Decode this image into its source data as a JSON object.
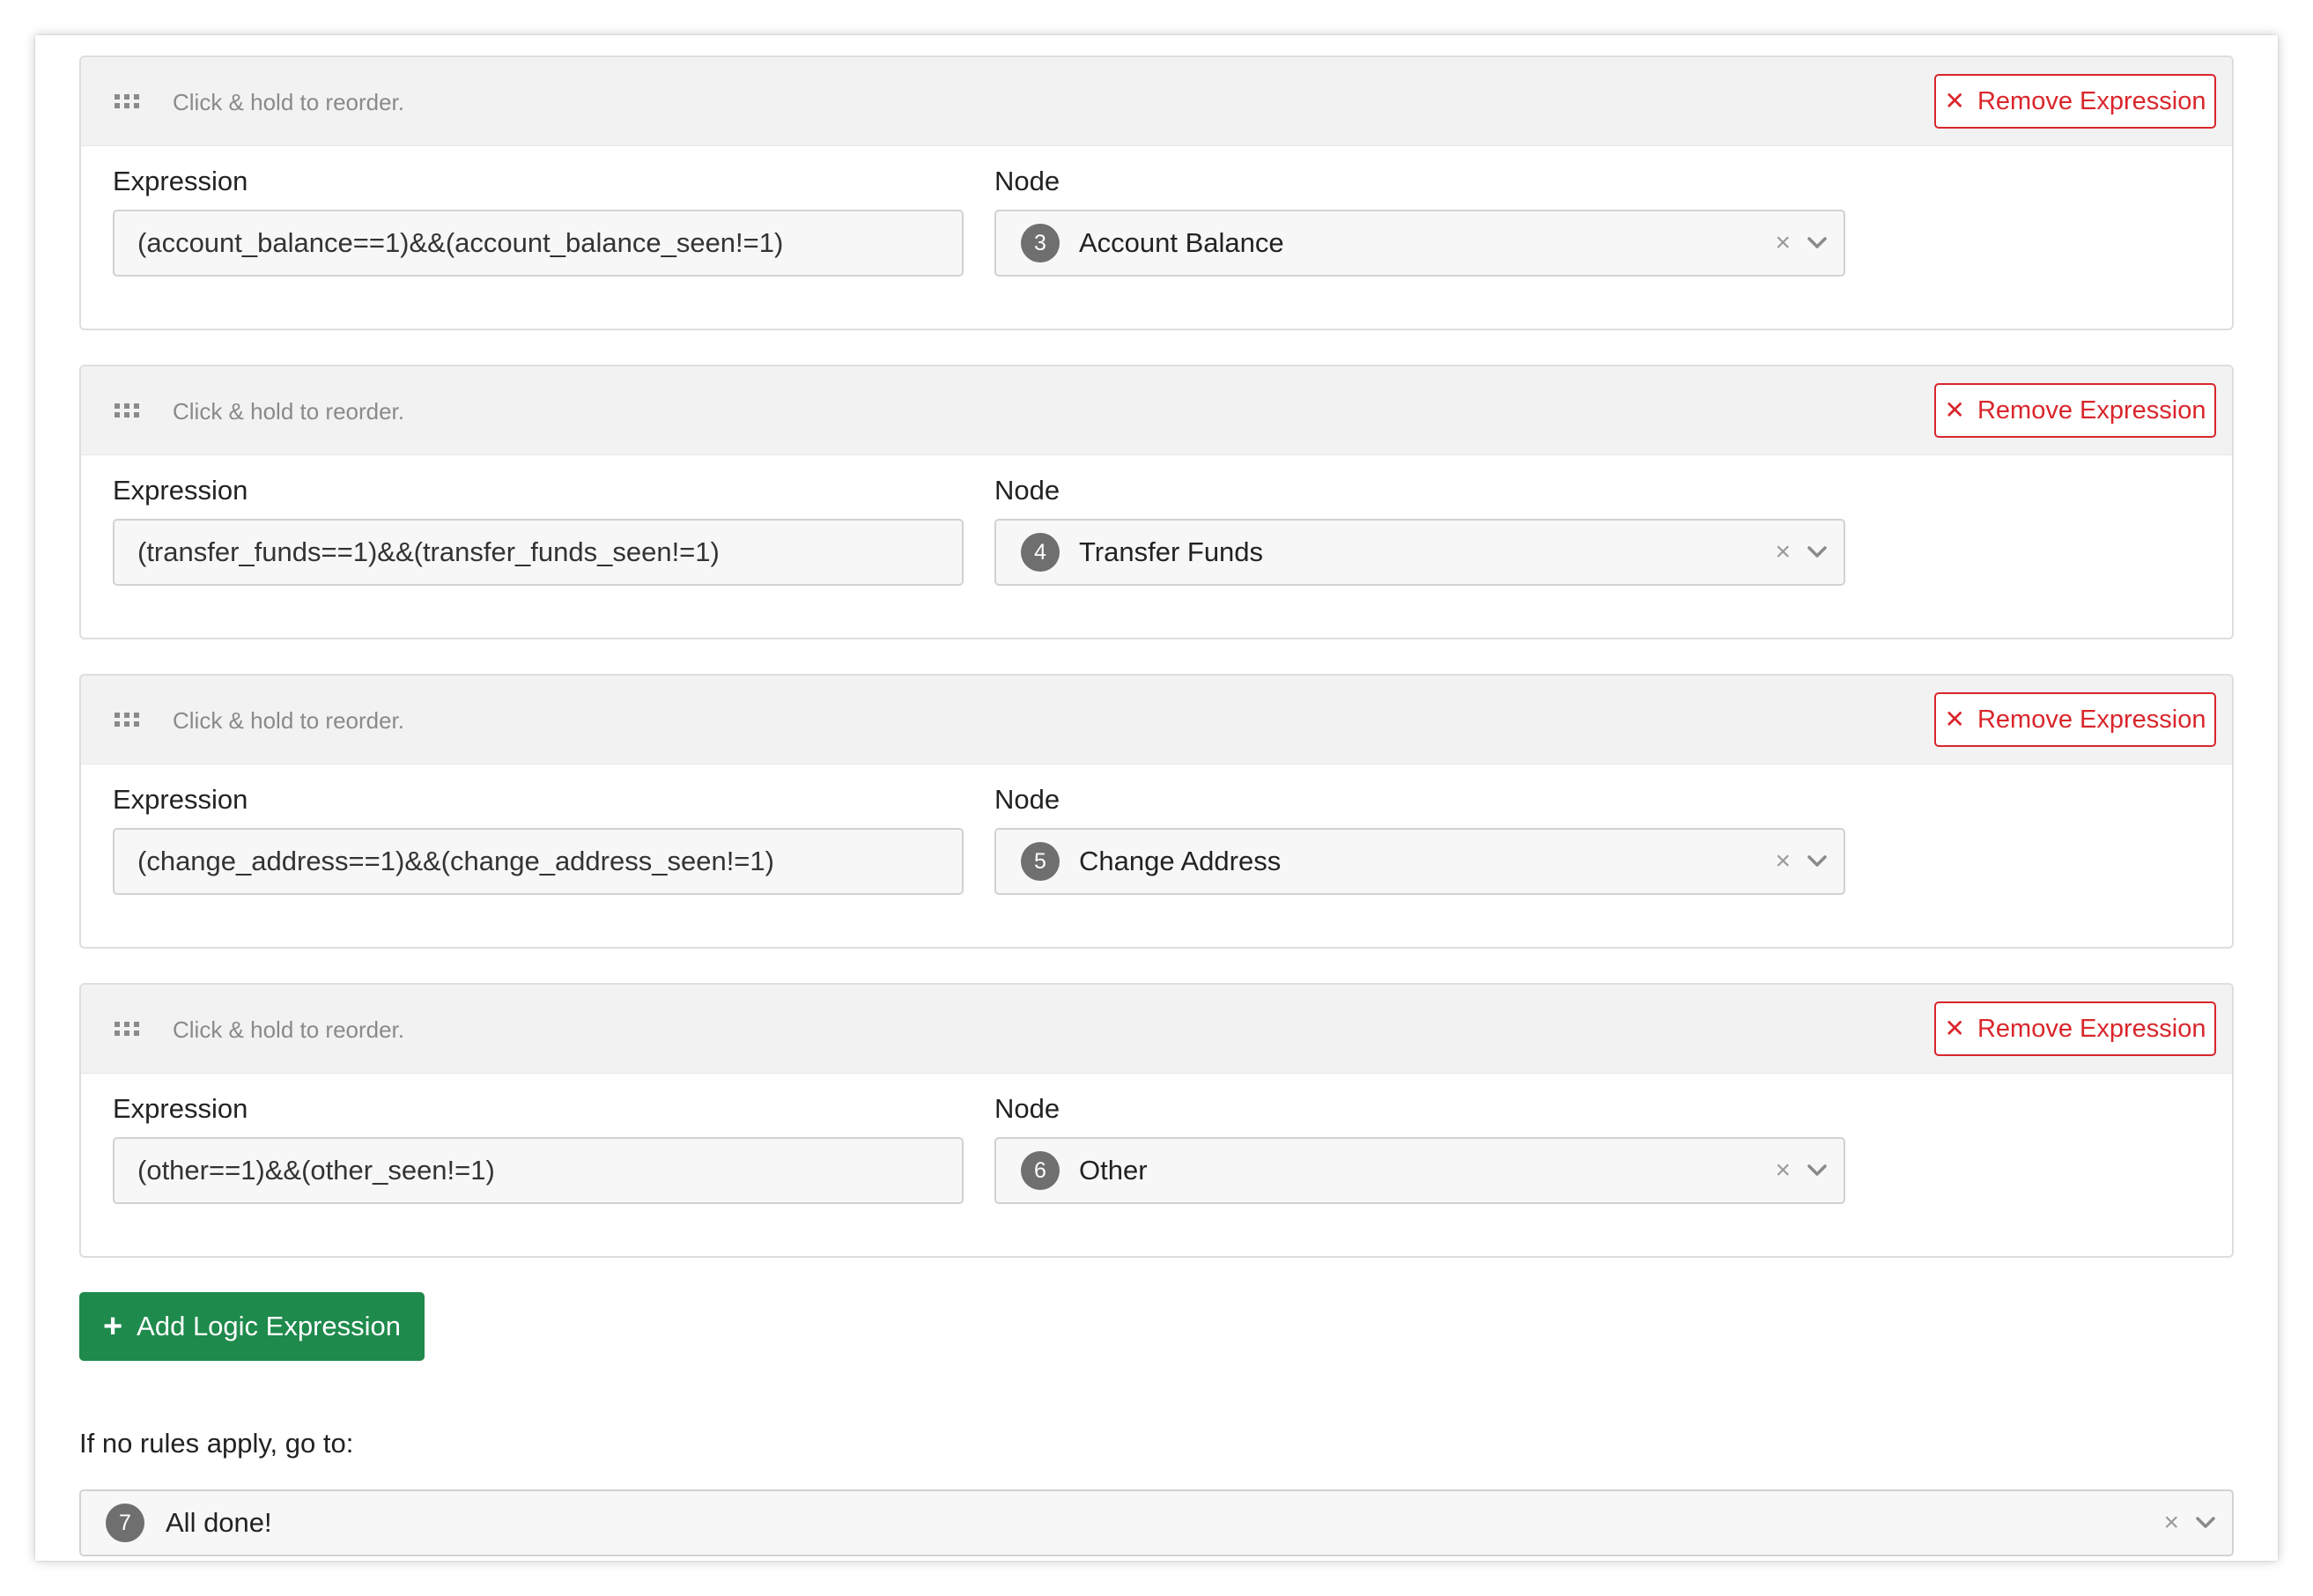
{
  "expressions": [
    {
      "reorder_hint": "Click & hold to reorder.",
      "remove_label": "Remove Expression",
      "expression_label": "Expression",
      "expression_value": "(account_balance==1)&&(account_balance_seen!=1)",
      "node_label": "Node",
      "node_number": "3",
      "node_name": "Account Balance"
    },
    {
      "reorder_hint": "Click & hold to reorder.",
      "remove_label": "Remove Expression",
      "expression_label": "Expression",
      "expression_value": "(transfer_funds==1)&&(transfer_funds_seen!=1)",
      "node_label": "Node",
      "node_number": "4",
      "node_name": "Transfer Funds"
    },
    {
      "reorder_hint": "Click & hold to reorder.",
      "remove_label": "Remove Expression",
      "expression_label": "Expression",
      "expression_value": "(change_address==1)&&(change_address_seen!=1)",
      "node_label": "Node",
      "node_number": "5",
      "node_name": "Change Address"
    },
    {
      "reorder_hint": "Click & hold to reorder.",
      "remove_label": "Remove Expression",
      "expression_label": "Expression",
      "expression_value": "(other==1)&&(other_seen!=1)",
      "node_label": "Node",
      "node_number": "6",
      "node_name": "Other"
    }
  ],
  "add_button_label": "Add Logic Expression",
  "fallback": {
    "label": "If no rules apply, go to:",
    "node_number": "7",
    "node_name": "All done!"
  },
  "icons": {
    "drag": "drag-handle-icon",
    "remove": "close-icon",
    "clear": "clear-icon",
    "dropdown": "chevron-down-icon",
    "add": "plus-icon"
  },
  "colors": {
    "danger": "#d9262b",
    "primary_green": "#1e8a4c",
    "header_bg": "#f2f2f2",
    "badge_bg": "#6f6f6f"
  }
}
